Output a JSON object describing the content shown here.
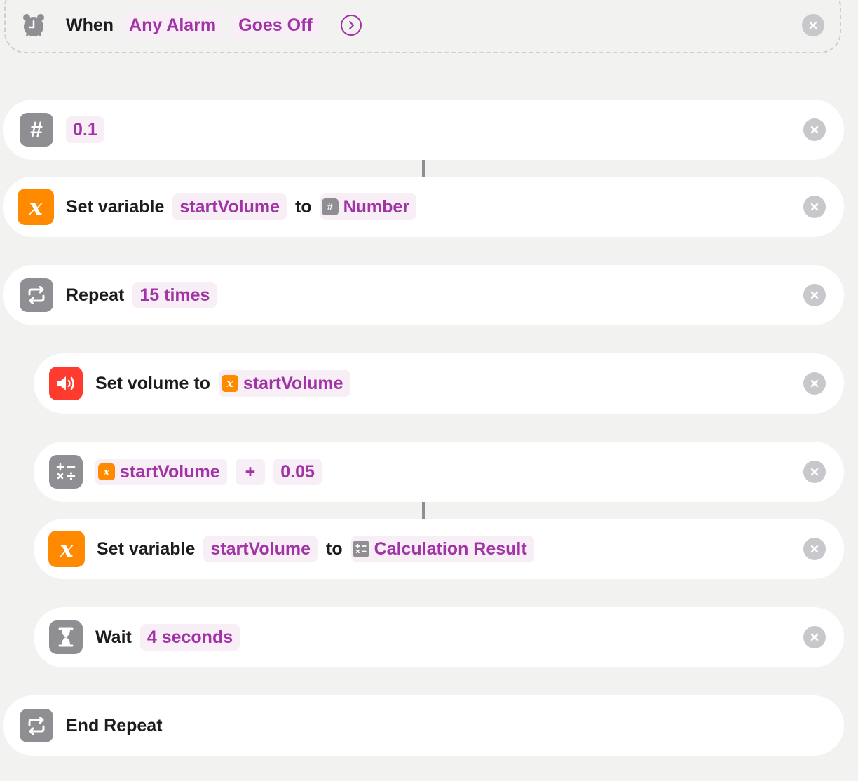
{
  "trigger": {
    "icon": "alarm-clock-icon",
    "when_label": "When",
    "alarm_token": "Any Alarm",
    "event_token": "Goes Off",
    "expand_icon": "chevron-right-circle-icon"
  },
  "actions": {
    "number": {
      "icon": "number-sign-icon",
      "value": "0.1"
    },
    "set_var_1": {
      "icon": "variable-x-icon",
      "label": "Set variable",
      "variable": "startVolume",
      "to_label": "to",
      "value_icon": "number-sign-icon",
      "value": "Number"
    },
    "repeat": {
      "icon": "repeat-icon",
      "label": "Repeat",
      "times": "15 times"
    },
    "set_volume": {
      "icon": "speaker-icon",
      "label": "Set volume to",
      "value_icon": "variable-x-icon",
      "value": "startVolume"
    },
    "calculate": {
      "icon": "calculator-icon",
      "operand_icon": "variable-x-icon",
      "operand": "startVolume",
      "operator": "+",
      "amount": "0.05"
    },
    "set_var_2": {
      "icon": "variable-x-icon",
      "label": "Set variable",
      "variable": "startVolume",
      "to_label": "to",
      "value_icon": "calculator-icon",
      "value": "Calculation Result"
    },
    "wait": {
      "icon": "hourglass-icon",
      "label": "Wait",
      "duration": "4 seconds"
    },
    "end_repeat": {
      "icon": "repeat-icon",
      "label": "End Repeat"
    }
  },
  "colors": {
    "token_text": "#a133a6",
    "token_bg": "#f7eef6",
    "orange": "#ff8a00",
    "red": "#ff3b30",
    "gray_icon": "#8e8e93"
  }
}
